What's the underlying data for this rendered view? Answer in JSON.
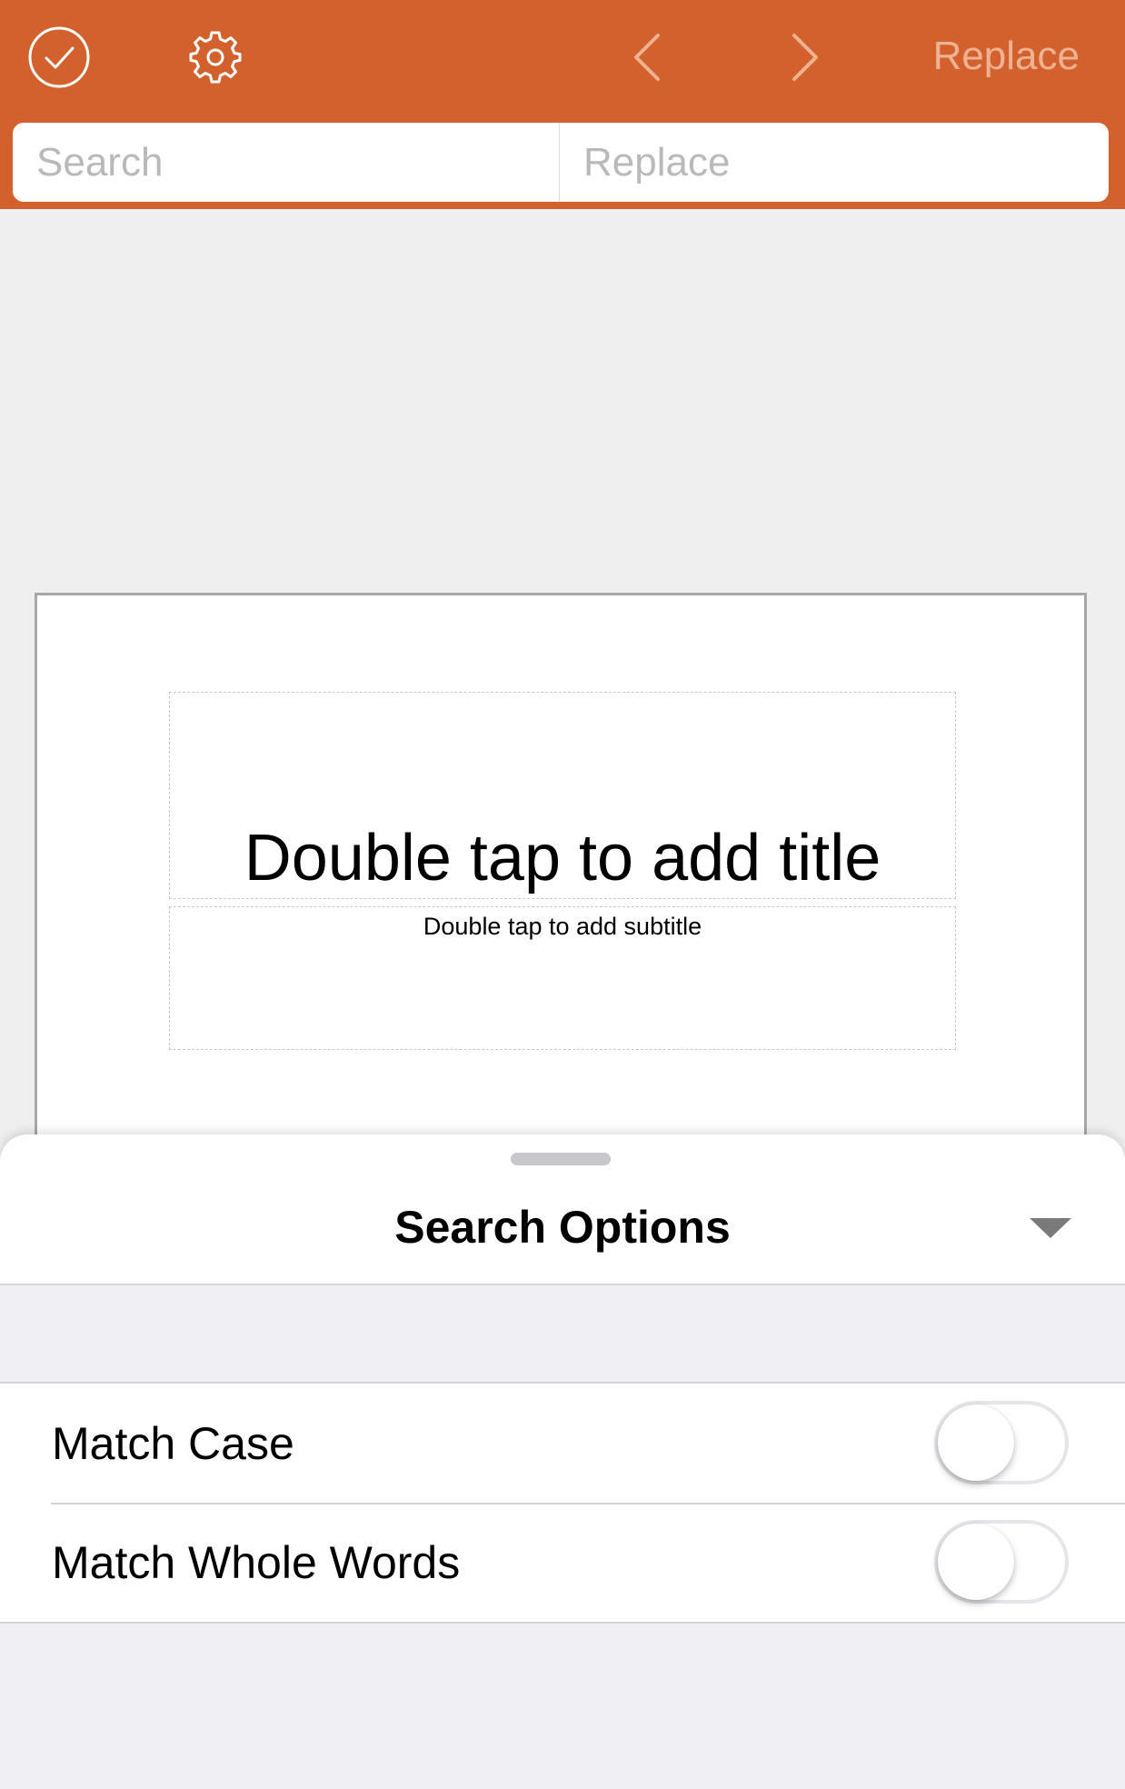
{
  "toolbar": {
    "done_icon": "checkmark-circle-icon",
    "settings_icon": "gear-icon",
    "prev_icon": "chevron-left-icon",
    "next_icon": "chevron-right-icon",
    "replace_label": "Replace",
    "bar_color": "#d2612e"
  },
  "search": {
    "search_placeholder": "Search",
    "search_value": "",
    "replace_placeholder": "Replace",
    "replace_value": ""
  },
  "slide": {
    "title_placeholder": "Double tap to add title",
    "subtitle_placeholder": "Double tap to add subtitle"
  },
  "sheet": {
    "title": "Search Options",
    "collapse_icon": "triangle-down-icon",
    "options": [
      {
        "label": "Match Case",
        "enabled": false
      },
      {
        "label": "Match Whole Words",
        "enabled": false
      }
    ]
  }
}
